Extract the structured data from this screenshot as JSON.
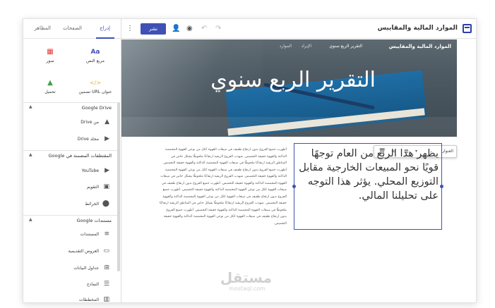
{
  "app": {
    "site_title": "الموارد المالية والمقاييس",
    "publish_label": "نشر",
    "toolbar_icons": [
      "more-vert-icon",
      "publish-button",
      "add-person-icon",
      "preview-eye-icon",
      "undo-icon",
      "redo-icon"
    ]
  },
  "panel": {
    "tabs": [
      {
        "label": "إدراج",
        "active": true
      },
      {
        "label": "الصفحات",
        "active": false
      },
      {
        "label": "المظاهر",
        "active": false
      }
    ],
    "insert_grid": [
      {
        "label": "مربع النص",
        "icon": "Aa",
        "icon_name": "text-box-icon",
        "color": "#3f51b5"
      },
      {
        "label": "صور",
        "icon": "▦",
        "icon_name": "images-icon",
        "color": "#e53935"
      },
      {
        "label": "عنوان URL تضمين",
        "icon": "</>",
        "icon_name": "embed-icon",
        "color": "#f9a825"
      },
      {
        "label": "تحميل",
        "icon": "▲",
        "icon_name": "upload-icon",
        "color": "#43a047"
      }
    ],
    "sections": [
      {
        "label": "Google Drive",
        "items": [
          {
            "label": "من Drive",
            "icon": "▲",
            "icon_name": "drive-icon"
          },
          {
            "label": "مجلد Drive",
            "icon": "▶",
            "icon_name": "drive-folder-icon"
          }
        ]
      },
      {
        "label": "المقتطفات المضمنة في Google",
        "items": [
          {
            "label": "YouTube",
            "icon": "▶",
            "icon_name": "youtube-icon"
          },
          {
            "label": "التقويم",
            "icon": "▣",
            "icon_name": "calendar-icon"
          },
          {
            "label": "الخرائط",
            "icon": "⬤",
            "icon_name": "map-pin-icon"
          }
        ]
      },
      {
        "label": "مستندات Google",
        "items": [
          {
            "label": "المستندات",
            "icon": "≡",
            "icon_name": "docs-icon"
          },
          {
            "label": "العروض التقديمية",
            "icon": "▭",
            "icon_name": "slides-icon"
          },
          {
            "label": "جداول البيانات",
            "icon": "⊞",
            "icon_name": "sheets-icon"
          },
          {
            "label": "النماذج",
            "icon": "☰",
            "icon_name": "forms-icon"
          },
          {
            "label": "المخططات",
            "icon": "▥",
            "icon_name": "charts-icon"
          }
        ]
      }
    ]
  },
  "hero": {
    "site_name": "الموارد المالية والمقاييس",
    "nav": [
      "التقرير الربع سنوي",
      "الإيراد",
      "الموارد"
    ],
    "title": "التقرير الربع سنوي",
    "toolbar_select": "العنوان"
  },
  "content": {
    "left_text": "أظهرت جميع الفروع بدون ارتفاع طفيف في مبيعات القهوة ككل من نوعي القهوة المحمصة الداكنة والقهوة خفيفة التحميص. شهدت الفروع الريفية ارتفاعًا ملحوظًا بشكل خاص في المناطق الريفية ارتفاعًا ملحوظًا في مبيعات القهوة المحمصة الداكنة والقهوة خفيفة التحميص. أظهرت جميع الفروع بدون ارتفاع طفيف في مبيعات القهوة ككل من نوعي القهوة المحمصة الداكنة والقهوة خفيفة التحميص. شهدت الفروع الريفية ارتفاعًا ملحوظًا بشكل خاص في مبيعات القهوة المحمصة الداكنة والقهوة خفيفة التحميص. أظهرت جميع الفروع بدون ارتفاع طفيف في مبيعات القهوة ككل من نوعي القهوة المحمصة الداكنة والقهوة خفيفة التحميص. أظهرت جميع الفروع بدون ارتفاع طفيف في مبيعات القهوة ككل من نوعي القهوة المحمصة الداكنة والقهوة خفيفة التحميص. شهدت الفروع الريفية ارتفاعًا ملحوظًا بشكل خاص في المناطق الريفية ارتفاعًا ملحوظًا في مبيعات القهوة المحمصة الداكنة والقهوة خفيفة التحميص. أظهرت جميع الفروع بدون ارتفاع طفيف في مبيعات القهوة ككل من نوعي القهوة المحمصة الداكنة والقهوة خفيفة التحميص.",
    "right_text": "يظهر هذا الربع من العام توجهًا قويًا نحو المبيعات الخارجية مقابل التوزيع المحلي. يؤثر هذا التوجه على تحليلنا المالي."
  },
  "watermark": {
    "main": "مستقل",
    "sub": "mostaql.com"
  },
  "colors": {
    "accent": "#3f51b5",
    "hero_bg": "#4d5963",
    "text": "#333333"
  }
}
